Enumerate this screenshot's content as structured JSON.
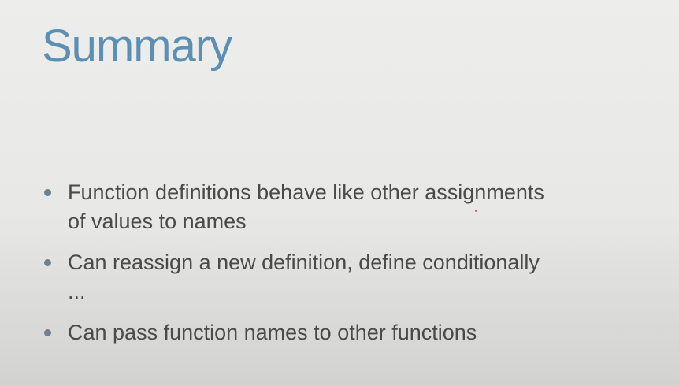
{
  "slide": {
    "title": "Summary",
    "bullets": [
      {
        "text": "Function definitions behave like other assignments\nof values to names"
      },
      {
        "text": "Can reassign a new definition, define conditionally\n..."
      },
      {
        "text": "Can pass function names to other functions"
      }
    ]
  },
  "colors": {
    "title": "#5b8fb4",
    "text": "#4a4a4a",
    "background": "#ececea"
  }
}
